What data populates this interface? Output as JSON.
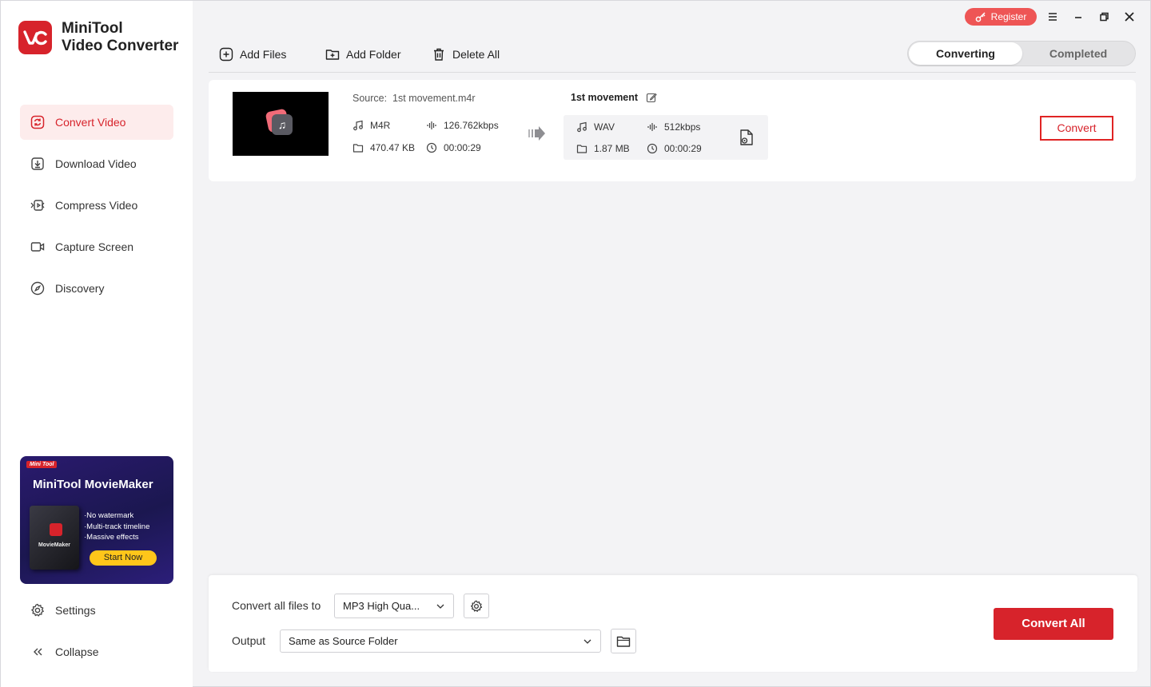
{
  "app": {
    "name_line1": "MiniTool",
    "name_line2": "Video Converter",
    "logo_text": "VC"
  },
  "titlebar": {
    "register_label": "Register",
    "icons": [
      "key-icon",
      "menu-icon",
      "minimize-icon",
      "restore-icon",
      "close-icon"
    ]
  },
  "sidebar": {
    "items": [
      {
        "label": "Convert Video",
        "icon": "convert-icon",
        "active": true
      },
      {
        "label": "Download Video",
        "icon": "download-icon",
        "active": false
      },
      {
        "label": "Compress Video",
        "icon": "compress-icon",
        "active": false
      },
      {
        "label": "Capture Screen",
        "icon": "camera-icon",
        "active": false
      },
      {
        "label": "Discovery",
        "icon": "compass-icon",
        "active": false
      }
    ],
    "settings_label": "Settings",
    "collapse_label": "Collapse"
  },
  "promo": {
    "badge": "Mini Tool",
    "title": "MiniTool MovieMaker",
    "box_name": "MovieMaker",
    "features": [
      "No watermark",
      "Multi-track timeline",
      "Massive effects"
    ],
    "cta": "Start Now"
  },
  "toolbar": {
    "add_files": "Add Files",
    "add_folder": "Add Folder",
    "delete_all": "Delete All"
  },
  "tabs": {
    "converting": "Converting",
    "completed": "Completed",
    "active": "converting"
  },
  "task": {
    "source_prefix": "Source:",
    "source_name": "1st movement.m4r",
    "source": {
      "format": "M4R",
      "bitrate": "126.762kbps",
      "size": "470.47 KB",
      "duration": "00:00:29"
    },
    "target_name": "1st movement",
    "target": {
      "format": "WAV",
      "bitrate": "512kbps",
      "size": "1.87 MB",
      "duration": "00:00:29"
    },
    "convert_label": "Convert"
  },
  "bottom": {
    "convert_all_label": "Convert all files to",
    "format_value": "MP3 High Qua...",
    "output_label": "Output",
    "output_value": "Same as Source Folder",
    "convert_all_button": "Convert All"
  },
  "colors": {
    "accent": "#d7232b",
    "register": "#ee5555",
    "promo_cta": "#ffc61a"
  }
}
